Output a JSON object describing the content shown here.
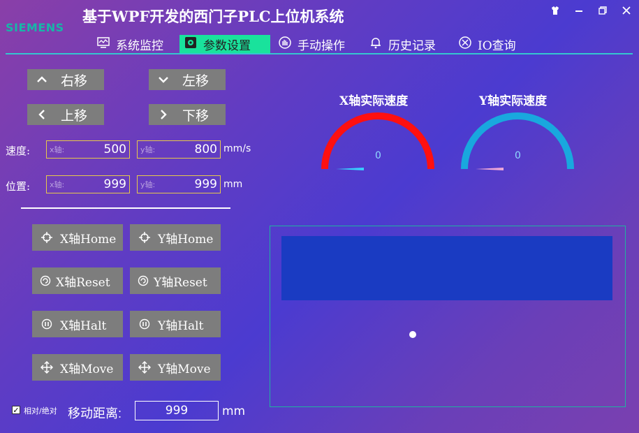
{
  "app": {
    "brand": "SIEMENS",
    "title": "基于WPF开发的西门子PLC上位机系统"
  },
  "nav": [
    {
      "label": "系统监控",
      "icon": "monitor-icon"
    },
    {
      "label": "参数设置",
      "icon": "gear-settings-icon",
      "active": true
    },
    {
      "label": "手动操作",
      "icon": "hand-icon"
    },
    {
      "label": "历史记录",
      "icon": "bell-icon"
    },
    {
      "label": "IO查询",
      "icon": "io-icon"
    }
  ],
  "moves": {
    "right": "右移",
    "left": "左移",
    "up": "上移",
    "down": "下移"
  },
  "speed": {
    "label": "速度:",
    "x_placeholder": "x轴:",
    "x_value": "500",
    "y_placeholder": "y轴:",
    "y_value": "800",
    "unit": "mm/s"
  },
  "position": {
    "label": "位置:",
    "x_placeholder": "x轴:",
    "x_value": "999",
    "y_placeholder": "y轴:",
    "y_value": "999",
    "unit": "mm"
  },
  "axis_buttons": [
    {
      "x": "X轴Home",
      "y": "Y轴Home",
      "icon": "crosshair-icon"
    },
    {
      "x": "X轴Reset",
      "y": "Y轴Reset",
      "icon": "reset-icon"
    },
    {
      "x": "X轴Halt",
      "y": "Y轴Halt",
      "icon": "pause-icon"
    },
    {
      "x": "X轴Move",
      "y": "Y轴Move",
      "icon": "move-icon"
    }
  ],
  "bottom": {
    "mode_label": "相对/绝对",
    "mode_checked": true,
    "distance_label": "移动距离:",
    "distance_value": "999",
    "distance_unit": "mm"
  },
  "gauges": [
    {
      "title": "X轴实际速度",
      "value": "0",
      "color": "#ff1010",
      "needle_color": "#38d0ff"
    },
    {
      "title": "Y轴实际速度",
      "value": "0",
      "color": "#19a8de",
      "needle_color": "#f0a8d8"
    }
  ],
  "colors": {
    "accent": "#19e29c",
    "brand": "#17b6a8",
    "button": "#7d7d7d",
    "field_border": "#e7c94a"
  }
}
